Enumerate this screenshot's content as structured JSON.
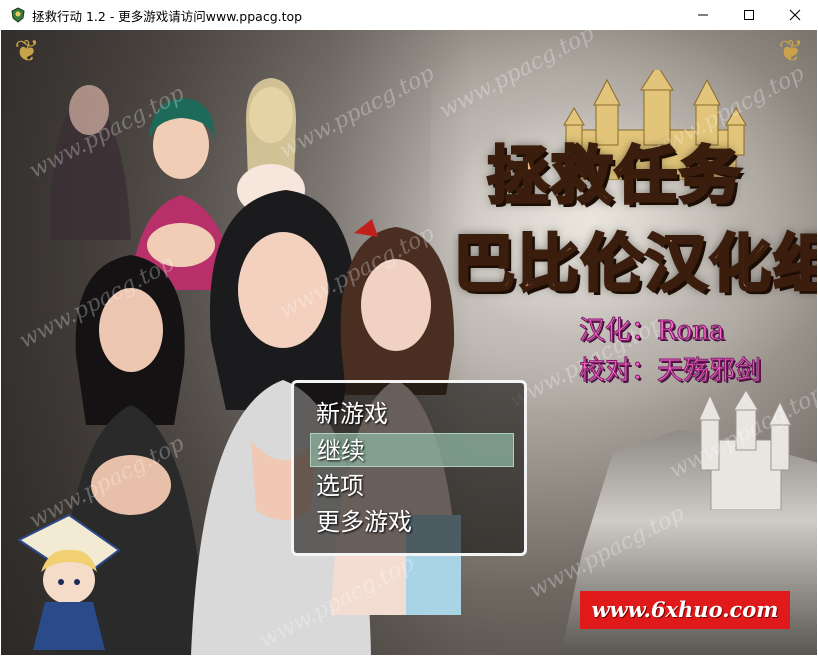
{
  "window": {
    "title": "拯救行动 1.2 - 更多游戏请访问www.ppacg.top",
    "controls": {
      "minimize": "—",
      "maximize": "☐",
      "close": "✕"
    }
  },
  "logo": {
    "line1": "拯救任务",
    "line2": "巴比伦汉化组"
  },
  "credits": {
    "translation": "汉化：Rona",
    "proofreading": "校对：天殇邪剑"
  },
  "menu": {
    "items": [
      {
        "label": "新游戏",
        "selected": false
      },
      {
        "label": "继续",
        "selected": true
      },
      {
        "label": "选项",
        "selected": false
      },
      {
        "label": "更多游戏",
        "selected": false
      }
    ]
  },
  "watermark_text": "www.ppacg.top",
  "banner": {
    "text": "www.6xhuo.com"
  },
  "colors": {
    "logo_fill": "#f0b37e",
    "credit_pink": "#ff66cc",
    "banner_red": "#e01a1a",
    "menu_highlight": "#8cb4a0"
  }
}
